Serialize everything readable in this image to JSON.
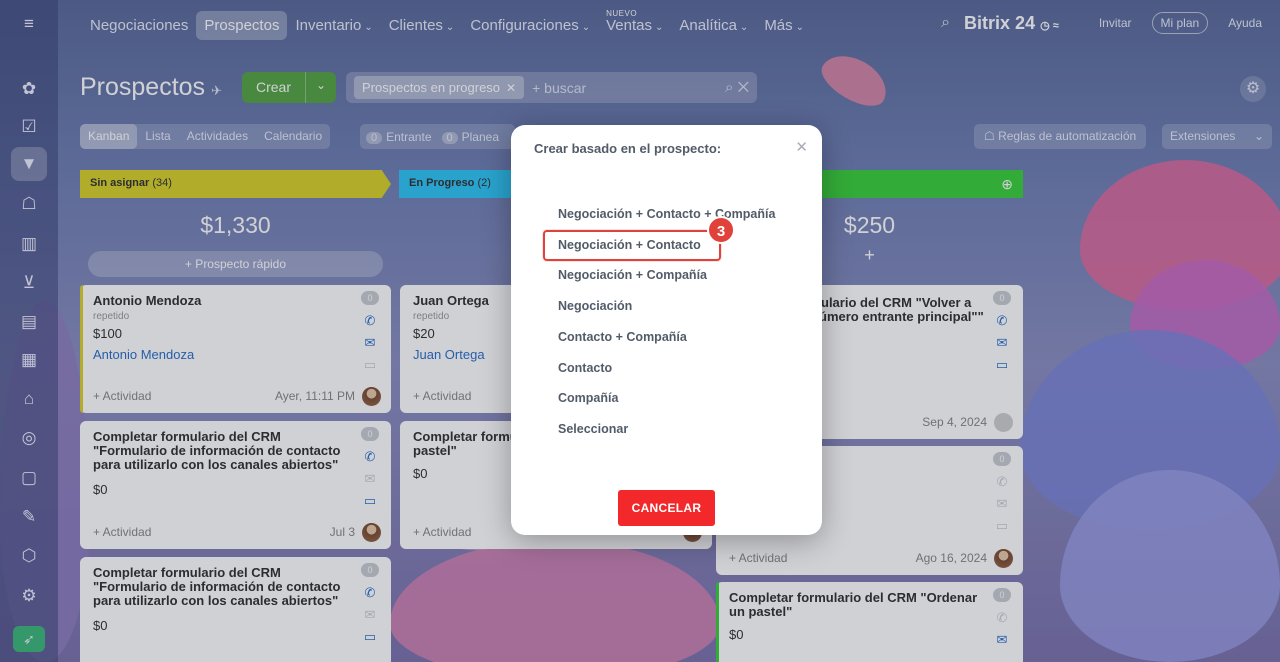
{
  "topnav": {
    "items": [
      "Negociaciones",
      "Prospectos",
      "Inventario",
      "Clientes",
      "Configuraciones",
      "Ventas",
      "Analítica",
      "Más"
    ],
    "new_label": "NUEVO",
    "brand": "Bitrix 24",
    "invite": "Invitar",
    "plan": "Mi plan",
    "help": "Ayuda"
  },
  "page": {
    "title": "Prospectos",
    "create_label": "Crear",
    "filter_chip": "Prospectos en progreso",
    "search_placeholder": "+ buscar"
  },
  "views": [
    "Kanban",
    "Lista",
    "Actividades",
    "Calendario"
  ],
  "counters": [
    {
      "count": "0",
      "label": "Entrante"
    },
    {
      "count": "0",
      "label": "Planea"
    }
  ],
  "automation_label": "Reglas de automatización",
  "extensions_label": "Extensiones",
  "columns": {
    "c1": {
      "name": "Sin asignar",
      "count": "(34)",
      "sum": "$1,330",
      "quick": "+ Prospecto rápido"
    },
    "c2": {
      "name": "En Progreso",
      "count": "(2)"
    },
    "c3": {
      "sum": "$250",
      "plus": "+"
    }
  },
  "cards": {
    "a": {
      "name": "Antonio Mendoza",
      "sub": "repetido",
      "amount": "$100",
      "contact": "Antonio Mendoza",
      "activity": "+ Actividad",
      "date": "Ayer, 11:11 PM",
      "badge": "0"
    },
    "b": {
      "name": "Completar formulario del CRM \"Formulario de información de contacto para utilizarlo con los canales abiertos\"",
      "amount": "$0",
      "activity": "+ Actividad",
      "date": "Jul 3",
      "badge": "0"
    },
    "c": {
      "name": "Completar formulario del CRM \"Formulario de información de contacto para utilizarlo con los canales abiertos\"",
      "amount": "$0",
      "badge": "0"
    },
    "d": {
      "name": "Juan Ortega",
      "sub": "repetido",
      "amount": "$20",
      "contact": "Juan Ortega",
      "activity": "+ Actividad"
    },
    "e": {
      "name": "Completar formu",
      "name2": "pastel\"",
      "amount": "$0",
      "activity": "+ Actividad"
    },
    "f": {
      "name": "ulario del CRM \"Volver a",
      "name2": "úmero entrante principal\"\"",
      "date": "Sep 4, 2024",
      "badge": "0"
    },
    "g": {
      "activity": "+ Actividad",
      "date": "Ago 16, 2024",
      "badge": "0"
    },
    "h": {
      "name": "Completar formulario del CRM \"Ordenar un pastel\"",
      "amount": "$0",
      "badge": "0"
    }
  },
  "modal": {
    "title": "Crear basado en el prospecto:",
    "options": [
      "Negociación + Contacto + Compañía",
      "Negociación + Contacto",
      "Negociación + Compañía",
      "Negociación",
      "Contacto + Compañía",
      "Contacto",
      "Compañía",
      "Seleccionar"
    ],
    "step": "3",
    "cancel": "CANCELAR"
  },
  "colors": {
    "accent_green": "#55a544",
    "highlight_red": "#e0423b",
    "cancel_red": "#f3282a",
    "col1": "#d9d32a",
    "col2": "#2fc6f6",
    "col3": "#3bd03b"
  }
}
